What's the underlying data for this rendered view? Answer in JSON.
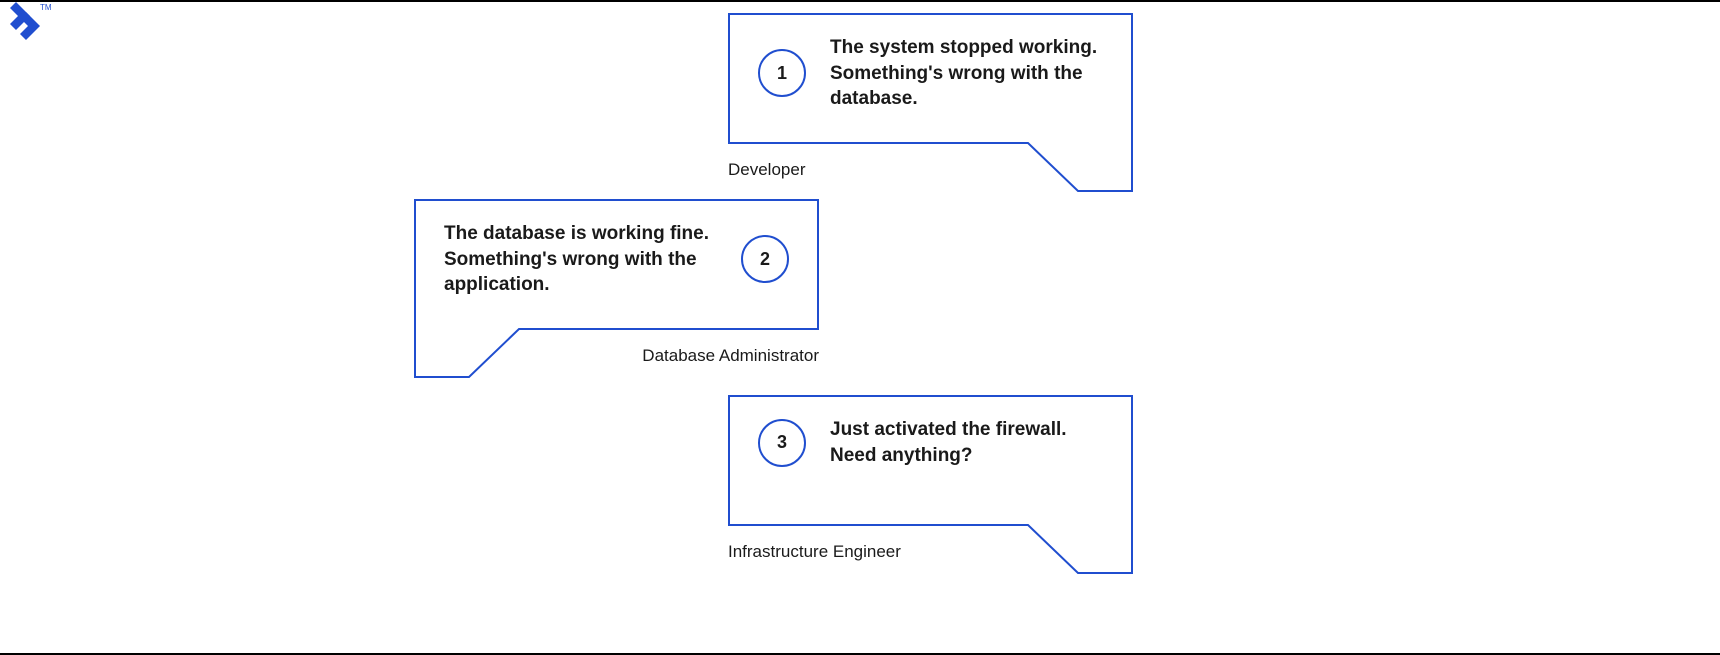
{
  "logo": {
    "tm": "TM"
  },
  "bubbles": [
    {
      "number": "1",
      "message": "The system stopped working. Something's wrong with the database.",
      "role": "Developer"
    },
    {
      "number": "2",
      "message": "The database is working fine. Something's wrong with the application.",
      "role": "Database Administrator"
    },
    {
      "number": "3",
      "message": "Just activated the firewall. Need anything?",
      "role": "Infrastructure Engineer"
    }
  ]
}
